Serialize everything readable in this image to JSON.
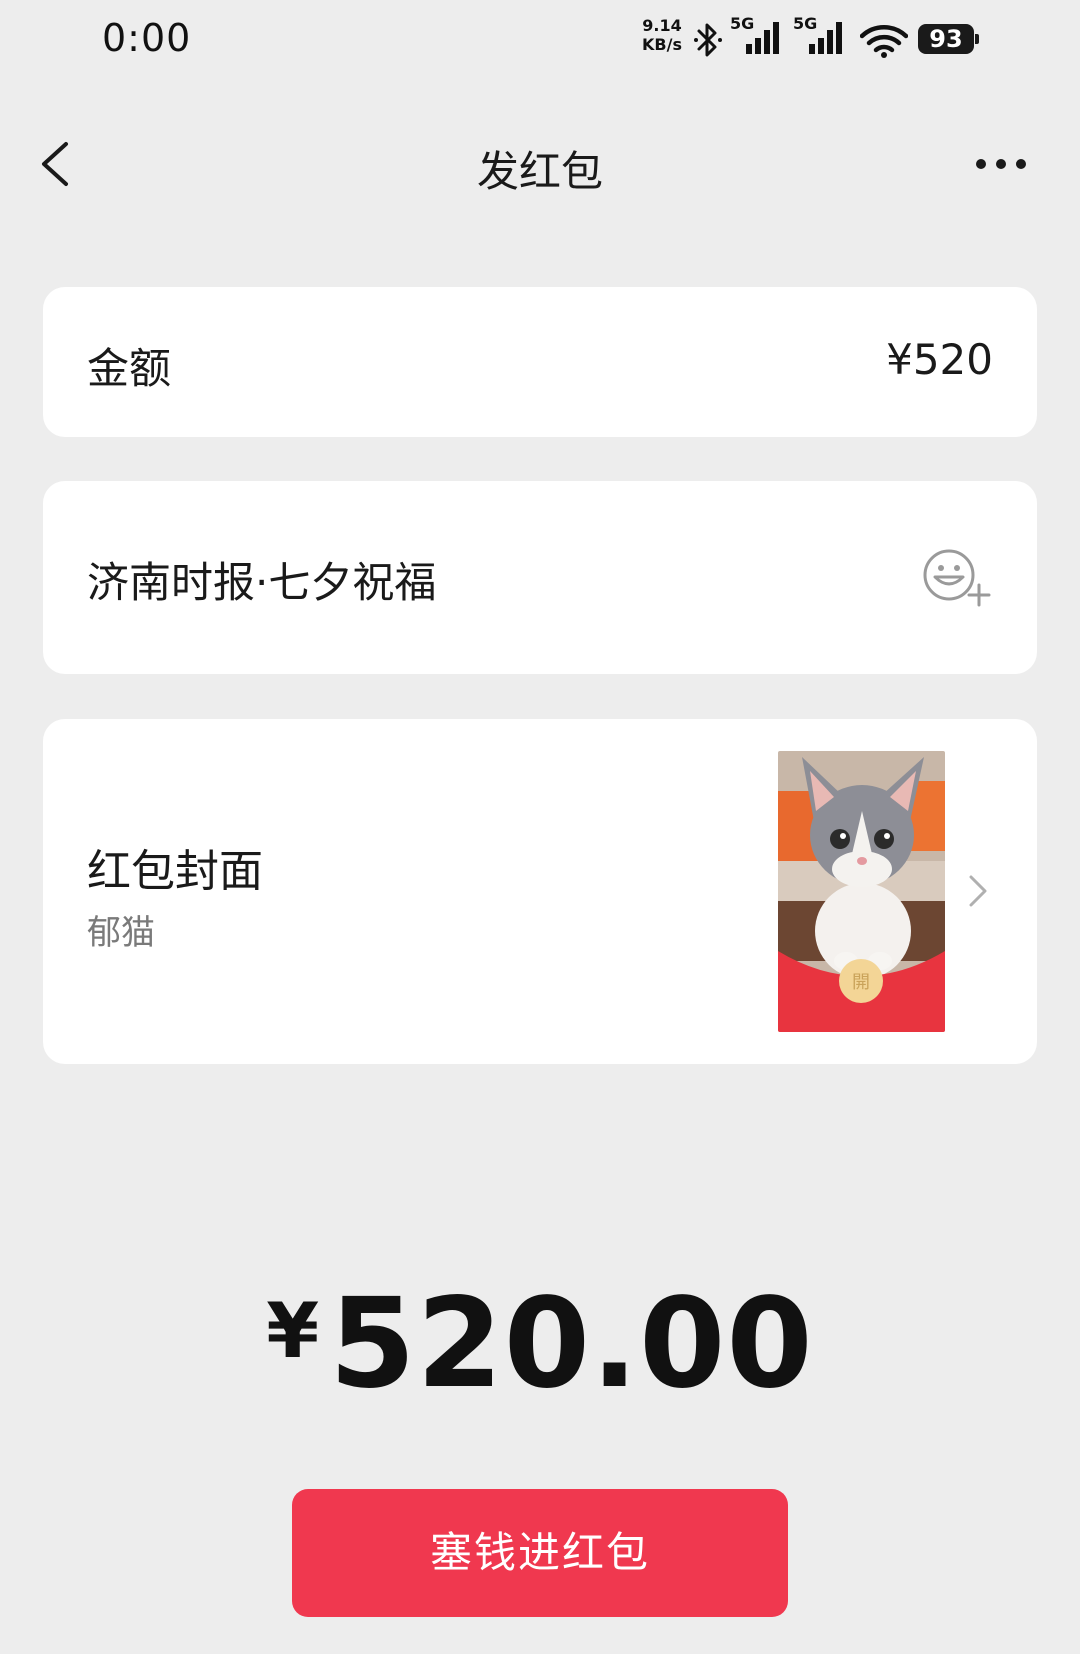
{
  "status_bar": {
    "time": "0:00",
    "net_speed_value": "9.14",
    "net_speed_unit": "KB/s",
    "sim1_label": "5G",
    "sim2_label": "5G",
    "battery": "93",
    "icons": [
      "bluetooth-icon",
      "signal-icon",
      "signal-icon",
      "wifi-icon",
      "battery-icon"
    ]
  },
  "header": {
    "title": "发红包",
    "back_icon": "chevron-left-icon",
    "more_icon": "more-dots-icon"
  },
  "amount_row": {
    "label": "金额",
    "value": "¥520"
  },
  "message_row": {
    "text": "济南时报·七夕祝福",
    "emoji_icon": "emoji-add-icon"
  },
  "cover_row": {
    "label": "红包封面",
    "name": "郁猫",
    "thumbnail": "cat-cover-image",
    "chevron": "chevron-right-icon"
  },
  "total": {
    "currency": "¥",
    "amount": "520.00"
  },
  "submit": {
    "label": "塞钱进红包"
  },
  "colors": {
    "background": "#ededed",
    "card": "#ffffff",
    "button": "#f0384f",
    "cover_red": "#e8343f"
  }
}
